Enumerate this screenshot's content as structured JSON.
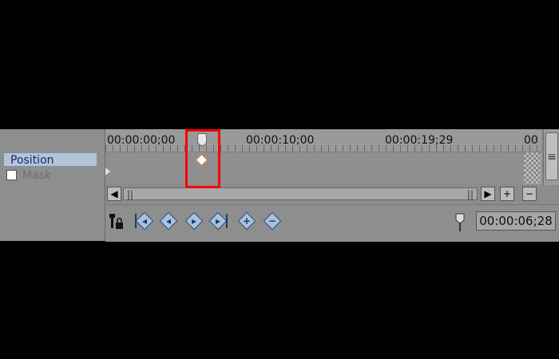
{
  "tracks": [
    {
      "label": "Position"
    },
    {
      "label": "Mask"
    }
  ],
  "ruler": {
    "labels": [
      "00:00:00;00",
      "00:00:10;00",
      "00:00:19;29",
      "00"
    ]
  },
  "scrollbar": {
    "left_arrow": "◀",
    "right_arrow": "▶",
    "zoom_in": "+",
    "zoom_out": "−",
    "grip": "||"
  },
  "toolbar": {
    "lock_icon": "lock-icon",
    "current_time": "00:00:06;28"
  },
  "colors": {
    "highlight": "#ff0000",
    "selected_track": "#b4c4d8",
    "keyframe_accent": "#c07030"
  }
}
